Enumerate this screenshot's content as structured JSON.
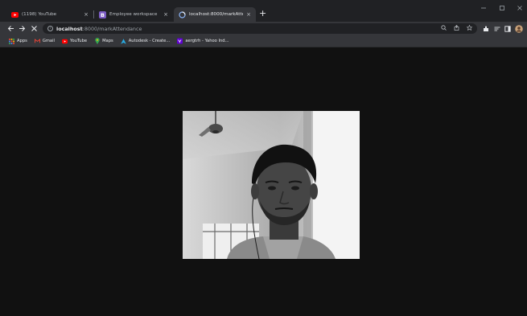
{
  "browser": {
    "tabs": [
      {
        "title": "(1198) YouTube",
        "favicon": "youtube-icon",
        "favicon_color": "#ff0000",
        "active": false
      },
      {
        "title": "Employee workspace",
        "favicon": "b-logo-icon",
        "favicon_color": "#7b5cc4",
        "active": false
      },
      {
        "title": "localhost:8000/markAttendance",
        "favicon": "loading-globe-icon",
        "favicon_color": "#8ab4f8",
        "active": true
      }
    ],
    "new_tab_label": "+",
    "tab_close_glyph": "×"
  },
  "toolbar": {
    "url_host": "localhost",
    "url_path": ":8000/markAttendance"
  },
  "bookmarks": [
    {
      "label": "Apps",
      "icon": "apps-grid-icon"
    },
    {
      "label": "Gmail",
      "icon": "gmail-icon"
    },
    {
      "label": "YouTube",
      "icon": "youtube-icon"
    },
    {
      "label": "Maps",
      "icon": "maps-pin-icon"
    },
    {
      "label": "Autodesk - Create...",
      "icon": "autodesk-icon"
    },
    {
      "label": "aergtrh - Yahoo Ind...",
      "icon": "yahoo-icon"
    }
  ],
  "colors": {
    "tab_strip": "#202124",
    "toolbar": "#35363a",
    "page_background": "#111111"
  }
}
